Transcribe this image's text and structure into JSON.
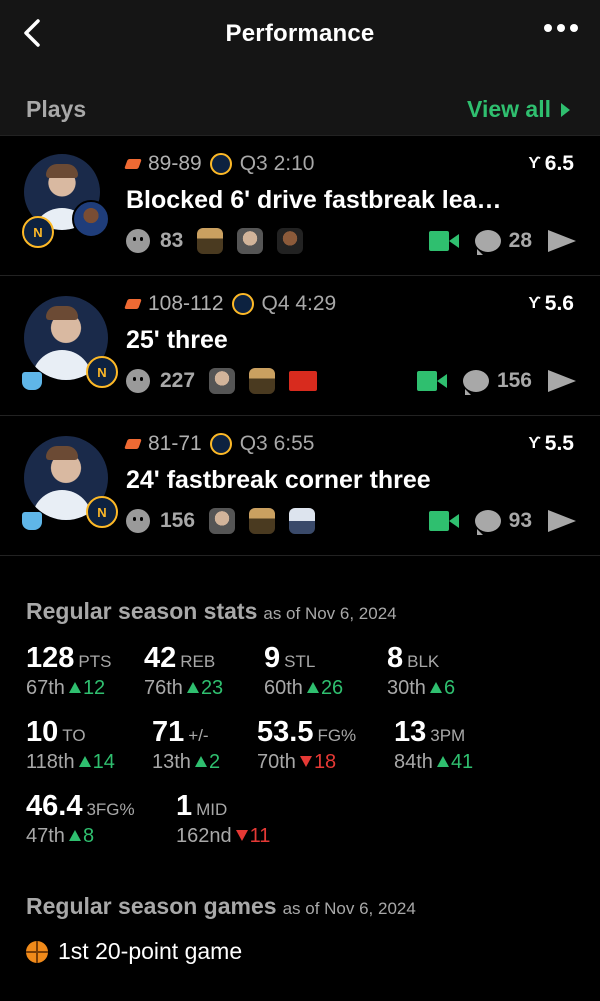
{
  "header": {
    "title": "Performance"
  },
  "plays_section": {
    "label": "Plays",
    "view_all": "View all"
  },
  "plays": [
    {
      "score": "89-89",
      "clock": "Q3 2:10",
      "rating": "6.5",
      "title": "Blocked 6' drive fastbreak lea…",
      "reactions": "83",
      "comments": "28"
    },
    {
      "score": "108-112",
      "clock": "Q4 4:29",
      "rating": "5.6",
      "title": "25' three",
      "reactions": "227",
      "comments": "156"
    },
    {
      "score": "81-71",
      "clock": "Q3 6:55",
      "rating": "5.5",
      "title": "24' fastbreak corner three",
      "reactions": "156",
      "comments": "93"
    }
  ],
  "stats_section": {
    "label": "Regular season stats",
    "as_of": "as of Nov 6, 2024"
  },
  "stats": [
    {
      "value": "128",
      "unit": "PTS",
      "rank": "67th",
      "dir": "up",
      "change": "12"
    },
    {
      "value": "42",
      "unit": "REB",
      "rank": "76th",
      "dir": "up",
      "change": "23"
    },
    {
      "value": "9",
      "unit": "STL",
      "rank": "60th",
      "dir": "up",
      "change": "26"
    },
    {
      "value": "8",
      "unit": "BLK",
      "rank": "30th",
      "dir": "up",
      "change": "6"
    },
    {
      "value": "10",
      "unit": "TO",
      "rank": "118th",
      "dir": "up",
      "change": "14"
    },
    {
      "value": "71",
      "unit": "+/-",
      "rank": "13th",
      "dir": "up",
      "change": "2"
    },
    {
      "value": "53.5",
      "unit": "FG%",
      "rank": "70th",
      "dir": "down",
      "change": "18"
    },
    {
      "value": "13",
      "unit": "3PM",
      "rank": "84th",
      "dir": "up",
      "change": "41"
    },
    {
      "value": "46.4",
      "unit": "3FG%",
      "rank": "47th",
      "dir": "up",
      "change": "8"
    },
    {
      "value": "1",
      "unit": "MID",
      "rank": "162nd",
      "dir": "down",
      "change": "11"
    }
  ],
  "games_section": {
    "label": "Regular season games",
    "as_of": "as of Nov 6, 2024"
  },
  "games": [
    {
      "label": "1st 20-point game",
      "icon": "basketball-icon"
    }
  ],
  "colors": {
    "accent": "#2fbf6f",
    "negative": "#e53935",
    "muted": "#a8a8a8",
    "background": "#000000"
  }
}
